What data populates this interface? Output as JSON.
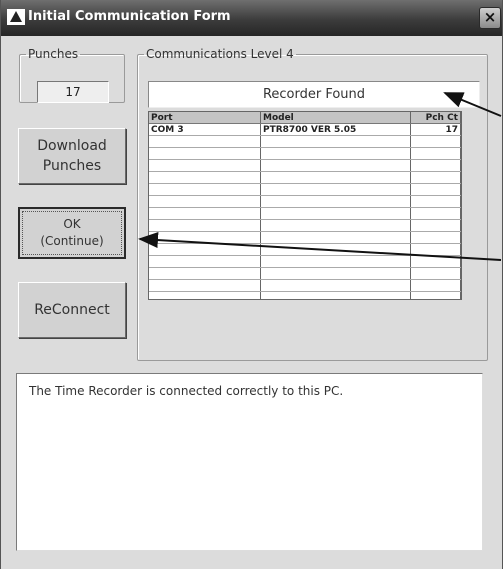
{
  "window": {
    "title": "Initial Communication Form",
    "close_label": "×"
  },
  "punches": {
    "legend": "Punches",
    "value": "17"
  },
  "buttons": {
    "download_line1": "Download",
    "download_line2": "Punches",
    "ok_line1": "OK",
    "ok_line2": "(Continue)",
    "reconnect": "ReConnect"
  },
  "communications": {
    "legend": "Communications Level 4",
    "status": "Recorder Found",
    "columns": [
      "Port",
      "Model",
      "Pch Ct"
    ],
    "rows": [
      [
        "COM 3",
        "PTR8700 VER 5.05",
        "17"
      ]
    ]
  },
  "message": "The Time Recorder is connected correctly to this PC.",
  "colors": {
    "titlebar": "#3c3c3c",
    "window_bg": "#dcdcdc",
    "arrow": "#111111"
  }
}
